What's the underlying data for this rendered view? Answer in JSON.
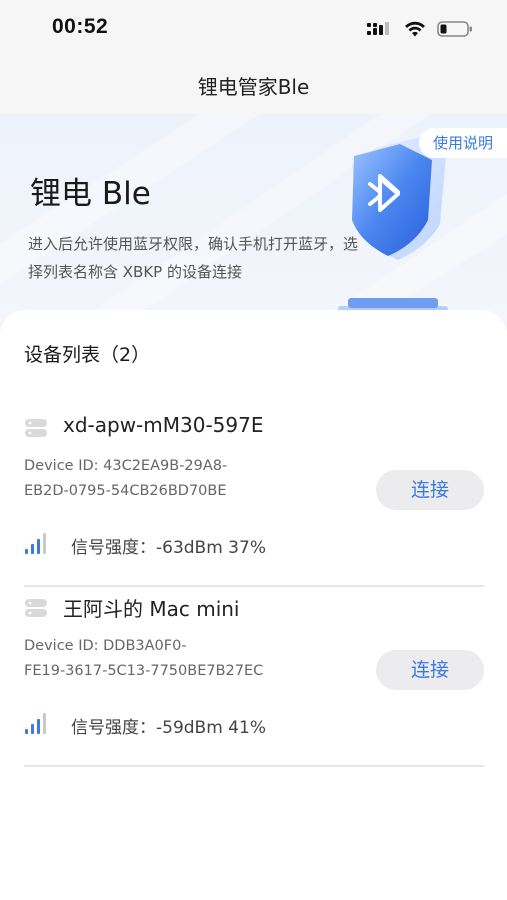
{
  "status": {
    "time": "00:52"
  },
  "nav": {
    "title": "锂电管家Ble"
  },
  "hero": {
    "title": "锂电 Ble",
    "description": "进入后允许使用蓝牙权限，确认手机打开蓝牙，选择列表名称含 XBKP 的设备连接",
    "help_label": "使用说明"
  },
  "device_list": {
    "header": "设备列表（2）",
    "devices": [
      {
        "name": "xd-apw-mM30-597E",
        "id_line1": "Device ID: 43C2EA9B-29A8-",
        "id_line2": "EB2D-0795-54CB26BD70BE",
        "connect_label": "连接",
        "signal": "信号强度：-63dBm 37%"
      },
      {
        "name": "王阿斗的 Mac mini",
        "id_line1": "Device ID: DDB3A0F0-",
        "id_line2": "FE19-3617-5C13-7750BE7B27EC",
        "connect_label": "连接",
        "signal": "信号强度：-59dBm 41%"
      }
    ]
  },
  "colors": {
    "accent": "#3b7ae0",
    "button_bg": "#ececee",
    "divider": "#e6e6e8"
  }
}
